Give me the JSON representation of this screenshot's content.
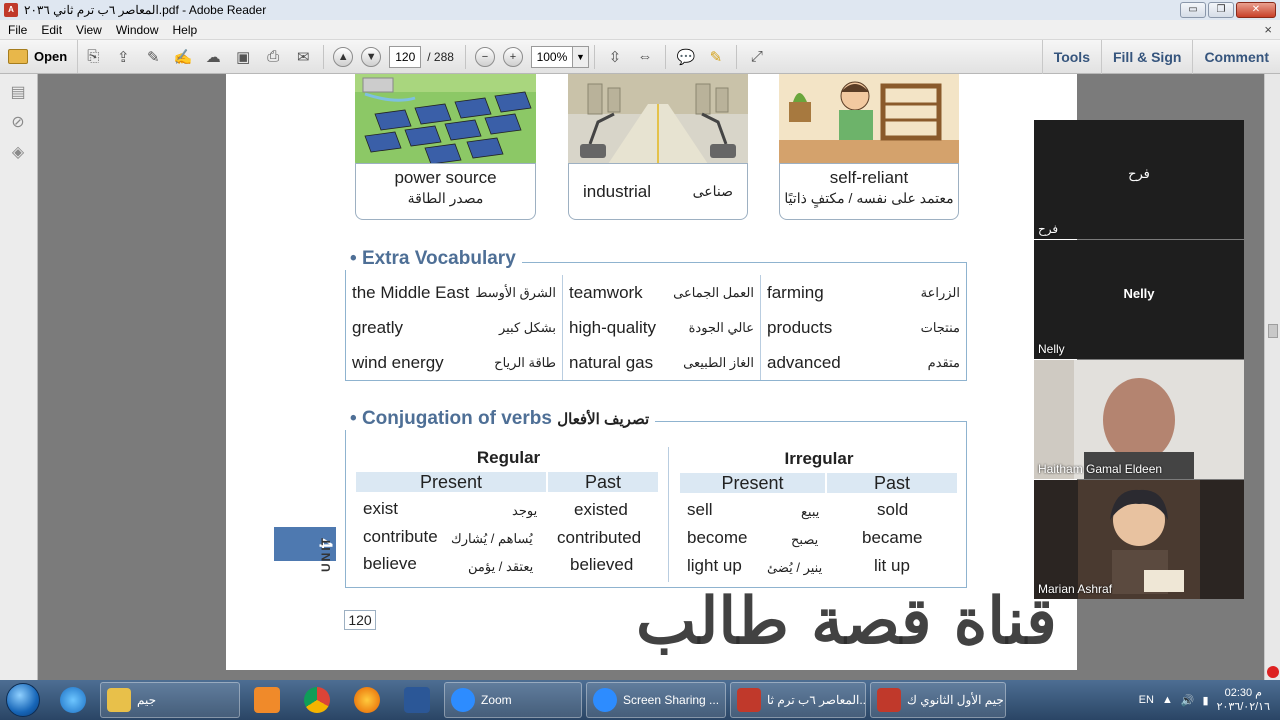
{
  "window": {
    "title": "المعاصر ٦ب ترم ثاني ٢٠٣٦.pdf - Adobe Reader",
    "controls": {
      "minimize": "▭",
      "restore": "❐",
      "close": "✕"
    }
  },
  "menu": {
    "items": [
      "File",
      "Edit",
      "View",
      "Window",
      "Help"
    ],
    "close_glyph": "×"
  },
  "toolbar": {
    "open_label": "Open",
    "page_current": "120",
    "page_total": "/ 288",
    "zoom": "100%",
    "right_buttons": [
      "Tools",
      "Fill & Sign",
      "Comment"
    ]
  },
  "page": {
    "cards": [
      {
        "en": "power source",
        "ar": "مصدر الطاقة"
      },
      {
        "en": "industrial",
        "ar": "صناعى"
      },
      {
        "en": "self-reliant",
        "ar": "معتمد على نفسه / مكتفٍ ذاتيًا"
      }
    ],
    "extra_vocab": {
      "title": "Extra Vocabulary",
      "rows": [
        [
          {
            "en": "the Middle East",
            "ar": "الشرق الأوسط"
          },
          {
            "en": "teamwork",
            "ar": "العمل الجماعى"
          },
          {
            "en": "farming",
            "ar": "الزراعة"
          }
        ],
        [
          {
            "en": "greatly",
            "ar": "بشكل كبير"
          },
          {
            "en": "high-quality",
            "ar": "عالي الجودة"
          },
          {
            "en": "products",
            "ar": "منتجات"
          }
        ],
        [
          {
            "en": "wind energy",
            "ar": "طاقة الرياح"
          },
          {
            "en": "natural gas",
            "ar": "الغاز الطبيعى"
          },
          {
            "en": "advanced",
            "ar": "متقدم"
          }
        ]
      ]
    },
    "conjugation": {
      "title": "Conjugation of verbs",
      "title_ar": "تصريف الأفعال",
      "regular": {
        "heading": "Regular",
        "present_label": "Present",
        "past_label": "Past",
        "rows": [
          {
            "present": "exist",
            "ar": "يوجد",
            "past": "existed"
          },
          {
            "present": "contribute",
            "ar": "يُساهم / يُشارك",
            "past": "contributed"
          },
          {
            "present": "believe",
            "ar": "يعتقد / يؤمن",
            "past": "believed"
          }
        ]
      },
      "irregular": {
        "heading": "Irregular",
        "present_label": "Present",
        "past_label": "Past",
        "rows": [
          {
            "present": "sell",
            "ar": "يبيع",
            "past": "sold"
          },
          {
            "present": "become",
            "ar": "يصبح",
            "past": "became"
          },
          {
            "present": "light up",
            "ar": "ينير / يُضئ",
            "past": "lit up"
          }
        ]
      }
    },
    "unit_number": "4",
    "unit_label": "UNIT",
    "page_number": "120",
    "watermark": "قناة قصة طالب"
  },
  "participants": [
    {
      "center_name": "فرح",
      "label": "فرح"
    },
    {
      "center_name": "Nelly",
      "label": "Nelly"
    },
    {
      "center_name": "",
      "label": "Haitham Gamal Eldeen"
    },
    {
      "center_name": "",
      "label": "Marian Ashraf"
    }
  ],
  "taskbar": {
    "tasks": [
      {
        "label": "جيم",
        "icon": "folder-icon"
      },
      {
        "label": "Zoom",
        "icon": "zoom-icon"
      },
      {
        "label": "Screen Sharing ...",
        "icon": "zoom-icon"
      },
      {
        "label": "المعاصر ٦ب ترم ثا...",
        "icon": "pdf-icon"
      },
      {
        "label": "جيم الأول الثانوي ك...",
        "icon": "pdf-icon"
      }
    ],
    "lang": "EN",
    "time": "م 02:30",
    "date": "٢٠٣٦/٠٢/١٦"
  },
  "colors": {
    "accent_blue": "#4e6f96",
    "unit_tab": "#4e79b0",
    "table_border": "#8fb3cf",
    "header_fill": "#dbe8f3",
    "taskbar": "#2a4565"
  }
}
